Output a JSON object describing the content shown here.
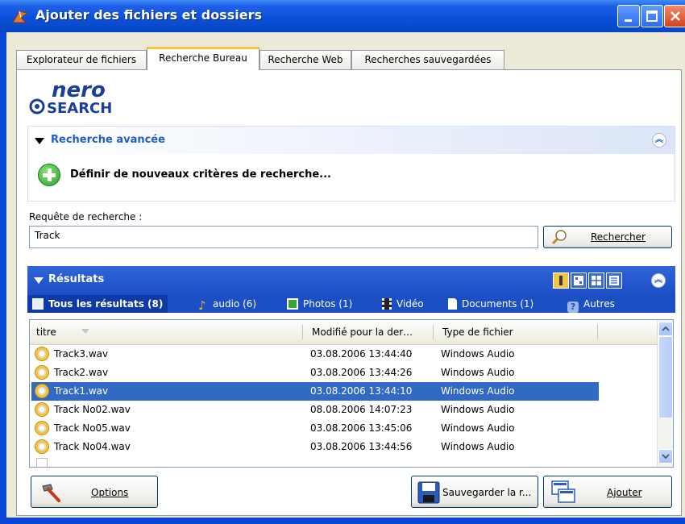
{
  "window": {
    "title": "Ajouter des fichiers et dossiers"
  },
  "tabs": [
    {
      "label": "Explorateur de fichiers",
      "active": false
    },
    {
      "label": "Recherche Bureau",
      "active": true
    },
    {
      "label": "Recherche Web",
      "active": false
    },
    {
      "label": "Recherches sauvegardées",
      "active": false
    }
  ],
  "logo": {
    "top": "nero",
    "bottom": "SEARCH"
  },
  "advanced": {
    "title": "Recherche avancée",
    "new_criteria": "Définir de nouveaux critères de recherche..."
  },
  "query": {
    "label": "Requête de recherche :",
    "value": "Track",
    "search_button": "Rechercher"
  },
  "results": {
    "title": "Résultats",
    "filters": [
      {
        "label": "Tous les résultats (8)",
        "selected": true
      },
      {
        "label": "audio (6)"
      },
      {
        "label": "Photos (1)"
      },
      {
        "label": "Vidéo"
      },
      {
        "label": "Documents (1)"
      },
      {
        "label": "Autres"
      }
    ],
    "columns": [
      "titre",
      "Modifié pour la der…",
      "Type de fichier"
    ],
    "rows": [
      {
        "title": "Track3.wav",
        "modified": "03.08.2006 13:44:40",
        "type": "Windows Audio",
        "selected": false
      },
      {
        "title": "Track2.wav",
        "modified": "03.08.2006 13:44:26",
        "type": "Windows Audio",
        "selected": false
      },
      {
        "title": "Track1.wav",
        "modified": "03.08.2006 13:44:10",
        "type": "Windows Audio",
        "selected": true
      },
      {
        "title": "Track No02.wav",
        "modified": "08.08.2006 14:07:23",
        "type": "Windows Audio",
        "selected": false
      },
      {
        "title": "Track No05.wav",
        "modified": "03.08.2006 13:45:06",
        "type": "Windows Audio",
        "selected": false
      },
      {
        "title": "Track No04.wav",
        "modified": "03.08.2006 13:44:56",
        "type": "Windows Audio",
        "selected": false
      }
    ]
  },
  "buttons": {
    "options": "Options",
    "save": "Sauvegarder la r...",
    "add": "Ajouter"
  },
  "colors": {
    "titlebar": "#0a4fd8",
    "selection": "#316ac5",
    "link": "#215dc6",
    "results_header": "#1c4fc3"
  }
}
